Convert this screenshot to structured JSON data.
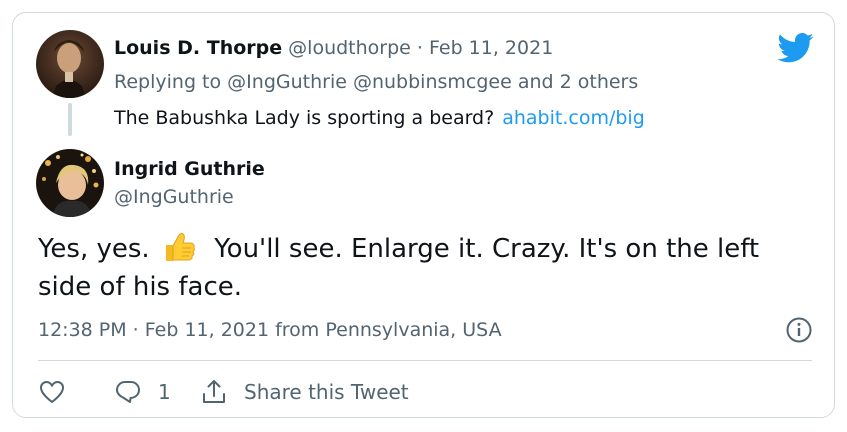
{
  "parent_tweet": {
    "author_name": "Louis D. Thorpe",
    "handle": "@loudthorpe",
    "separator": "·",
    "date": "Feb 11, 2021",
    "replying_prefix": "Replying to",
    "replying_mentions": "@IngGuthrie @nubbinsmcgee",
    "replying_suffix": "and 2 others",
    "text": "The Babushka Lady is sporting a beard?",
    "link": "ahabit.com/big"
  },
  "main_tweet": {
    "author_name": "Ingrid Guthrie",
    "handle": "@IngGuthrie",
    "text_part1": "Yes, yes.",
    "emoji": "thumbs-up-icon",
    "text_part2": "You'll see.  Enlarge it. Crazy. It's on the left side of his face.",
    "timestamp": "12:38 PM · Feb 11, 2021 from Pennsylvania, USA"
  },
  "actions": {
    "reply_count": "1",
    "share_label": "Share this Tweet"
  },
  "icons": {
    "brand": "twitter-bird-icon",
    "info": "info-icon",
    "like": "heart-icon",
    "reply": "reply-bubble-icon",
    "share": "share-icon"
  },
  "colors": {
    "brand": "#1d9bf0",
    "secondary_text": "#536471",
    "primary_text": "#0f1419",
    "border": "#cfd9de"
  }
}
